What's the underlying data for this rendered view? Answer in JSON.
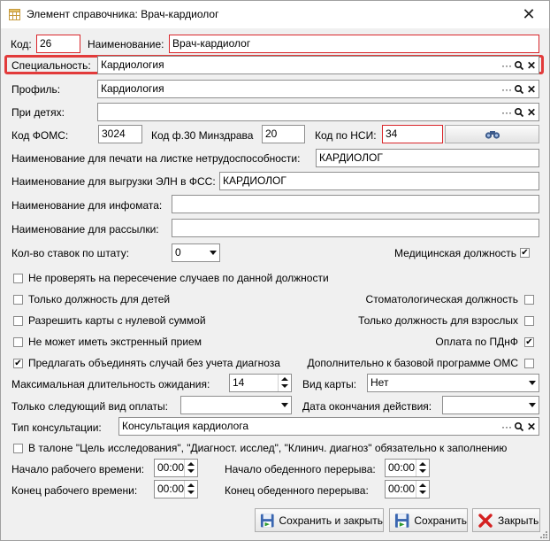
{
  "window": {
    "title": "Элемент справочника: Врач-кардиолог",
    "close_glyph": "✕"
  },
  "fields": {
    "kod_label": "Код:",
    "kod_value": "26",
    "name_label": "Наименование:",
    "name_value": "Врач-кардиолог",
    "specialty_label": "Специальность:",
    "specialty_value": "Кардиология",
    "profile_label": "Профиль:",
    "profile_value": "Кардиология",
    "children_label": "При детях:",
    "children_value": "",
    "foms_label": "Код ФОМС:",
    "foms_value": "3024",
    "f30_label": "Код ф.30 Минздрава",
    "f30_value": "20",
    "nsi_label": "Код по НСИ:",
    "nsi_value": "34",
    "print_label": "Наименование для печати на листке нетрудоспособности:",
    "print_value": "КАРДИОЛОГ",
    "eln_label": "Наименование для выгрузки ЭЛН в ФСС:",
    "eln_value": "КАРДИОЛОГ",
    "infomat_label": "Наименование для инфомата:",
    "infomat_value": "",
    "mailing_label": "Наименование для рассылки:",
    "mailing_value": "",
    "rates_label": "Кол-во ставок по штату:",
    "rates_value": "0"
  },
  "lookup_buttons": {
    "more": "···",
    "search": "search-icon",
    "clear": "✕"
  },
  "checkboxes": {
    "medical": {
      "label": "Медицинская должность",
      "checked": true
    },
    "no_overlap": {
      "label": "Не проверять на пересечение случаев по данной должности",
      "checked": false
    },
    "children_only": {
      "label": "Только должность для детей",
      "checked": false
    },
    "dental": {
      "label": "Стоматологическая должность",
      "checked": false
    },
    "zero_sum": {
      "label": "Разрешить карты с нулевой суммой",
      "checked": false
    },
    "adults_only": {
      "label": "Только должность для взрослых",
      "checked": false
    },
    "no_emergency": {
      "label": "Не может иметь экстренный прием",
      "checked": false
    },
    "pdnf": {
      "label": "Оплата по ПДнФ",
      "checked": true
    },
    "merge_cases": {
      "label": "Предлагать объединять случай без учета диагноза",
      "checked": true
    },
    "oms_extra": {
      "label": "Дополнительно к базовой программе ОМС",
      "checked": false
    },
    "talon": {
      "label": "В талоне \"Цель исследования\", \"Диагност. исслед\", \"Клинич. диагноз\" обязательно к заполнению",
      "checked": false
    }
  },
  "wait": {
    "label": "Максимальная длительность ожидания:",
    "value": "14"
  },
  "card_type": {
    "label": "Вид карты:",
    "value": "Нет"
  },
  "next_payment": {
    "label": "Только следующий вид оплаты:",
    "value": ""
  },
  "end_date": {
    "label": "Дата окончания действия:",
    "value": ""
  },
  "consult": {
    "label": "Тип консультации:",
    "value": "Консультация кардиолога"
  },
  "times": {
    "work_start_label": "Начало рабочего времени:",
    "work_start": "00:00",
    "work_end_label": "Конец рабочего времени:",
    "work_end": "00:00",
    "lunch_start_label": "Начало обеденного перерыва:",
    "lunch_start": "00:00",
    "lunch_end_label": "Конец обеденного перерыва:",
    "lunch_end": "00:00"
  },
  "buttons": {
    "save_close": "Сохранить и закрыть",
    "save": "Сохранить",
    "close": "Закрыть"
  },
  "colors": {
    "required_border": "#d9262b",
    "highlight": "#e23b3b"
  }
}
